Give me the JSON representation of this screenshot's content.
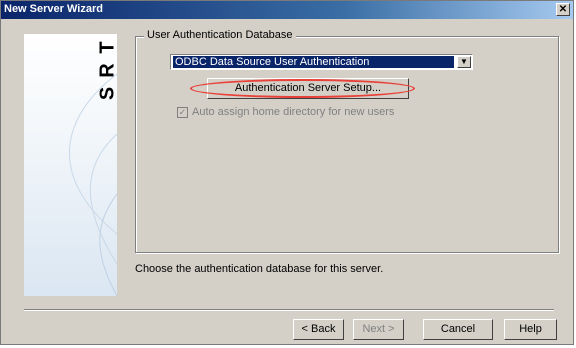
{
  "window": {
    "title": "New Server Wizard",
    "close_glyph": "✕"
  },
  "banner": {
    "letters": [
      "T",
      "R",
      "S"
    ]
  },
  "group": {
    "label": "User Authentication Database",
    "select_value": "ODBC Data Source User Authentication",
    "setup_button": "Authentication Server Setup...",
    "checkbox_label": "Auto assign home directory for new users",
    "checkbox_checked": true
  },
  "description": "Choose the authentication database for this server.",
  "buttons": {
    "back": "< Back",
    "next": "Next >",
    "cancel": "Cancel",
    "help": "Help"
  },
  "colors": {
    "highlight": "#e8413a",
    "selection": "#0a246a",
    "titlebar": "#0a246a"
  }
}
